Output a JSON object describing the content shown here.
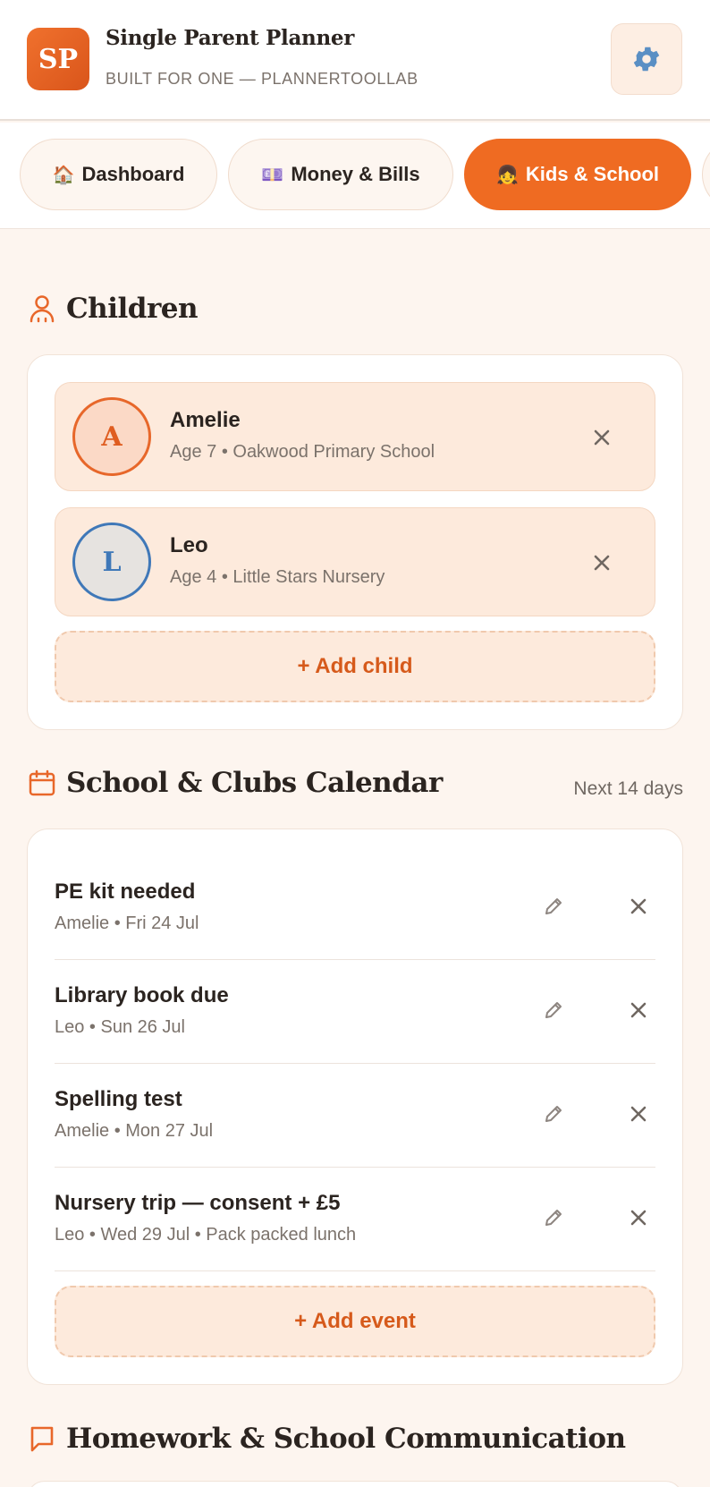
{
  "header": {
    "logo_text": "SP",
    "title": "Single Parent Planner",
    "subtitle": "BUILT FOR ONE — PLANNERTOOLLAB",
    "settings_icon": "gear-icon"
  },
  "tabs": [
    {
      "icon": "🏠",
      "label": "Dashboard",
      "active": false
    },
    {
      "icon": "💷",
      "label": "Money & Bills",
      "active": false
    },
    {
      "icon": "👧",
      "label": "Kids & School",
      "active": true
    }
  ],
  "children_section": {
    "title": "Children",
    "children": [
      {
        "initial": "A",
        "name": "Amelie",
        "detail": "Age 7 • Oakwood Primary School"
      },
      {
        "initial": "L",
        "name": "Leo",
        "detail": "Age 4 • Little Stars Nursery"
      }
    ],
    "add_label": "+ Add child"
  },
  "calendar_section": {
    "title": "School & Clubs Calendar",
    "range_label": "Next 14 days",
    "events": [
      {
        "title": "PE kit needed",
        "detail": "Amelie • Fri 24 Jul"
      },
      {
        "title": "Library book due",
        "detail": "Leo • Sun 26 Jul"
      },
      {
        "title": "Spelling test",
        "detail": "Amelie • Mon 27 Jul"
      },
      {
        "title": "Nursery trip — consent + £5",
        "detail": "Leo • Wed 29 Jul • Pack packed lunch"
      }
    ],
    "add_label": "+ Add event"
  },
  "homework_section": {
    "title": "Homework & School Communication"
  },
  "colors": {
    "accent": "#ef6b22",
    "background": "#fdf5ef",
    "child_card": "#fdeadc"
  }
}
